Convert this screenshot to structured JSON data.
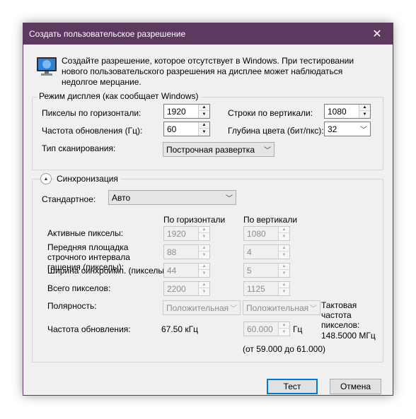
{
  "window": {
    "title": "Создать пользовательское разрешение",
    "close_glyph": "✕"
  },
  "intro": {
    "icon": "monitor-icon",
    "text": "Создайте разрешение, которое отсутствует в Windows. При тестировании нового пользовательского разрешения на дисплее может наблюдаться недолгое мерцание."
  },
  "display_mode": {
    "legend": "Режим дисплея (как сообщает Windows)",
    "h_pixels_label": "Пикселы по горизонтали:",
    "h_pixels_value": "1920",
    "v_lines_label": "Строки по вертикали:",
    "v_lines_value": "1080",
    "refresh_label": "Частота обновления (Гц):",
    "refresh_value": "60",
    "color_depth_label": "Глубина цвета (бит/пкс):",
    "color_depth_value": "32",
    "scan_label": "Тип сканирования:",
    "scan_value": "Построчная развертка"
  },
  "sync": {
    "legend": "Синхронизация",
    "standard_label": "Стандартное:",
    "standard_value": "Авто",
    "col_horizontal": "По горизонтали",
    "col_vertical": "По вертикали",
    "rows": [
      {
        "label": "Активные пикселы:",
        "h": "1920",
        "v": "1080"
      },
      {
        "label": "Передняя площадка строчного интервала гашения (пикселы):",
        "h": "88",
        "v": "4"
      },
      {
        "label": "Ширина синхроимп. (пикселы):",
        "h": "44",
        "v": "5"
      },
      {
        "label": "Всего пикселов:",
        "h": "2200",
        "v": "1125"
      }
    ],
    "polarity_label": "Полярность:",
    "polarity_h": "Положительная",
    "polarity_v": "Положительная",
    "pixel_clock_label": "Тактовая частота пикселов:",
    "pixel_clock_value": "148.5000 МГц",
    "refresh_label": "Частота обновления:",
    "refresh_h_value": "67.50 кГц",
    "refresh_v_value": "60.000",
    "refresh_v_unit": "Гц",
    "refresh_range": "(от 59.000 до 61.000)"
  },
  "buttons": {
    "test": "Тест",
    "cancel": "Отмена"
  }
}
